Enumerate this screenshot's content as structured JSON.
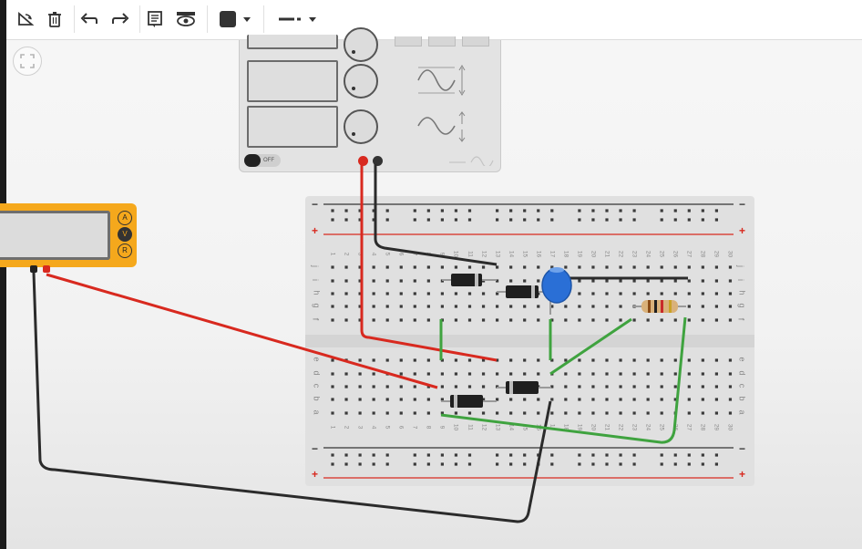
{
  "toolbar": {
    "buttons": [
      {
        "name": "rotate-button",
        "icon": "rotate-icon"
      },
      {
        "name": "delete-button",
        "icon": "trash-icon"
      },
      {
        "name": "undo-button",
        "icon": "undo-icon"
      },
      {
        "name": "redo-button",
        "icon": "redo-icon"
      },
      {
        "name": "notes-button",
        "icon": "notes-icon"
      },
      {
        "name": "visibility-button",
        "icon": "eye-icon"
      }
    ],
    "fill_color": "#333333",
    "line_style": "solid"
  },
  "function_generator": {
    "power_state": "OFF",
    "colors": {
      "positive_terminal": "#d8291f",
      "negative_terminal": "#333333"
    }
  },
  "multimeter": {
    "modes": [
      "A",
      "V",
      "R"
    ],
    "selected_mode": "V",
    "body_color": "#f5a81c"
  },
  "breadboard": {
    "columns": [
      "1",
      "2",
      "3",
      "4",
      "5",
      "6",
      "7",
      "8",
      "9",
      "10",
      "11",
      "12",
      "13",
      "14",
      "15",
      "16",
      "17",
      "18",
      "19",
      "20",
      "21",
      "22",
      "23",
      "24",
      "25",
      "26",
      "27",
      "28",
      "29",
      "30"
    ],
    "top_rows": [
      "j",
      "i",
      "h",
      "g",
      "f"
    ],
    "bottom_rows": [
      "e",
      "d",
      "c",
      "b",
      "a"
    ],
    "rail_minus": "−",
    "rail_plus": "+",
    "colors": {
      "rail_negative": "#333333",
      "rail_positive": "#d8291f"
    }
  },
  "wires": {
    "colors": {
      "red": "#d8291f",
      "black": "#2b2b2b",
      "green": "#3fa33f"
    }
  },
  "components": {
    "capacitor_color": "#2a6fd6",
    "diode_color": "#1f1f1f",
    "resistor_color": "#d9b17a"
  }
}
